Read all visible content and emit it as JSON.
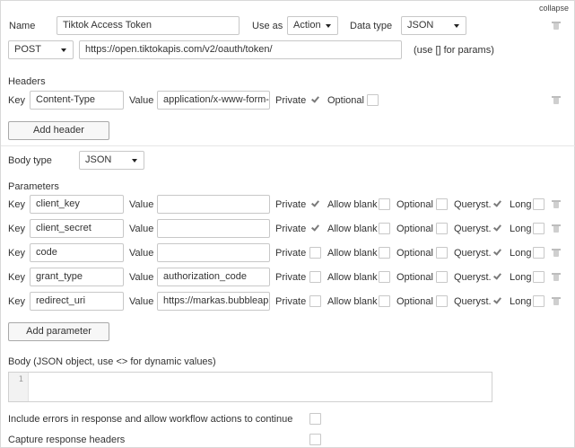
{
  "collapse_label": "collapse",
  "name_label": "Name",
  "name_value": "Tiktok Access Token",
  "use_as_label": "Use as",
  "use_as_value": "Action",
  "data_type_label": "Data type",
  "data_type_value": "JSON",
  "method_value": "POST",
  "url_value": "https://open.tiktokapis.com/v2/oauth/token/",
  "url_hint": "(use [] for params)",
  "headers_title": "Headers",
  "header": {
    "key_label": "Key",
    "key_value": "Content-Type",
    "value_label": "Value",
    "value_value": "application/x-www-form-urlencoded",
    "private_label": "Private",
    "private_checked": true,
    "optional_label": "Optional",
    "optional_checked": false
  },
  "add_header_label": "Add header",
  "body_type_label": "Body type",
  "body_type_value": "JSON",
  "parameters_title": "Parameters",
  "param_labels": {
    "key": "Key",
    "value": "Value",
    "private": "Private",
    "allow_blank": "Allow blank",
    "optional": "Optional",
    "queryst": "Queryst.",
    "long": "Long"
  },
  "parameters": [
    {
      "key": "client_key",
      "value": "",
      "private": true,
      "allow_blank": false,
      "optional": false,
      "queryst": true,
      "long": false
    },
    {
      "key": "client_secret",
      "value": "",
      "private": true,
      "allow_blank": false,
      "optional": false,
      "queryst": true,
      "long": false
    },
    {
      "key": "code",
      "value": "",
      "private": false,
      "allow_blank": false,
      "optional": false,
      "queryst": true,
      "long": false
    },
    {
      "key": "grant_type",
      "value": "authorization_code",
      "private": false,
      "allow_blank": false,
      "optional": false,
      "queryst": true,
      "long": false
    },
    {
      "key": "redirect_uri",
      "value": "https://markas.bubbleapps.io",
      "private": false,
      "allow_blank": false,
      "optional": false,
      "queryst": true,
      "long": false
    }
  ],
  "add_parameter_label": "Add parameter",
  "body_title": "Body (JSON object, use <> for dynamic values)",
  "body_line_number": "1",
  "include_errors_label": "Include errors in response and allow workflow actions to continue",
  "capture_headers_label": "Capture response headers"
}
